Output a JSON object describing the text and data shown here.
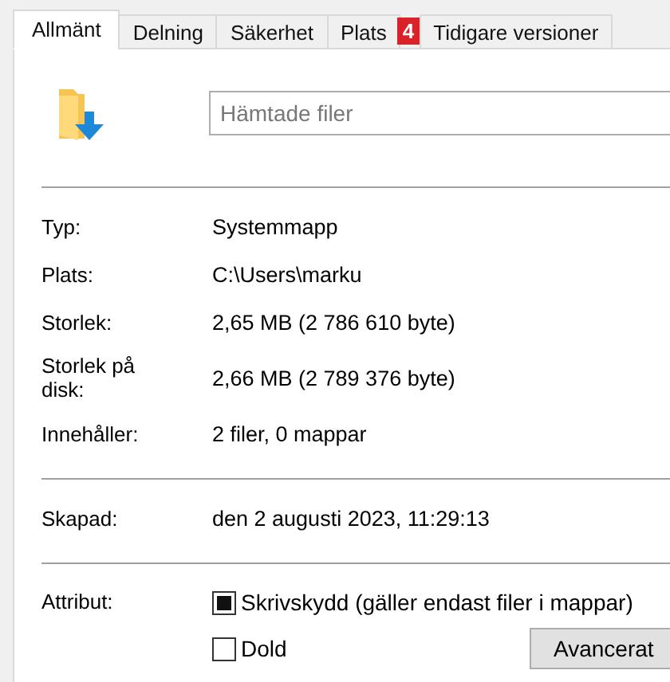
{
  "tabs": [
    {
      "label": "Allmänt",
      "selected": true
    },
    {
      "label": "Delning",
      "selected": false
    },
    {
      "label": "Säkerhet",
      "selected": false
    },
    {
      "label": "Plats",
      "selected": false,
      "badge": "4"
    },
    {
      "label": "Tidigare versioner",
      "selected": false
    }
  ],
  "name_field": {
    "placeholder": "Hämtade filer"
  },
  "sections": [
    [
      {
        "label": "Typ:",
        "value": "Systemmapp"
      },
      {
        "label": "Plats:",
        "value": "C:\\Users\\marku"
      },
      {
        "label": "Storlek:",
        "value": "2,65 MB (2 786 610 byte)"
      },
      {
        "label": "Storlek på disk:",
        "value": "2,66 MB (2 789 376 byte)"
      },
      {
        "label": "Innehåller:",
        "value": "2 filer, 0 mappar"
      }
    ],
    [
      {
        "label": "Skapad:",
        "value": "den 2 augusti 2023, 11:29:13"
      }
    ]
  ],
  "attributes": {
    "label": "Attribut:",
    "checkboxes": [
      {
        "label": "Skrivskydd (gäller endast filer i mappar)",
        "checked": false,
        "indeterminate": true
      },
      {
        "label": "Dold",
        "checked": false,
        "indeterminate": false
      }
    ],
    "button": "Avancerat"
  }
}
